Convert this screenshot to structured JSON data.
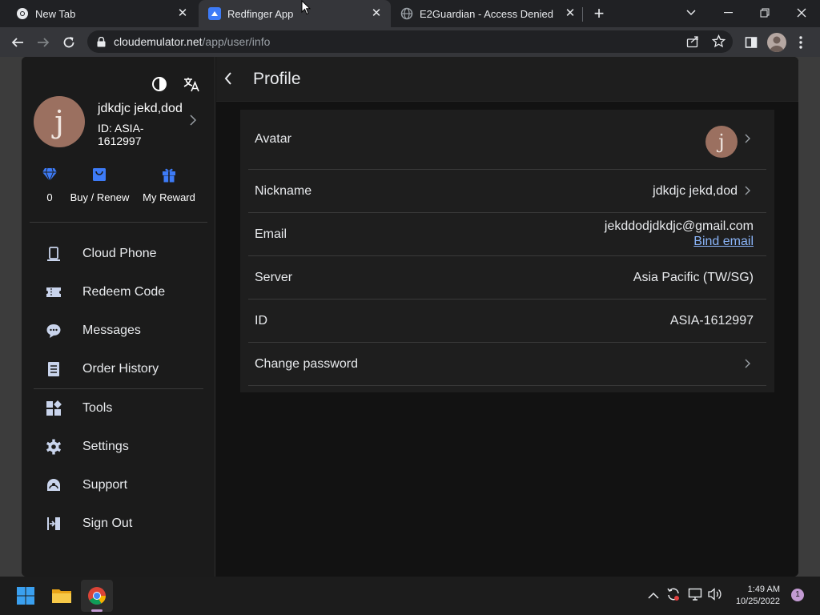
{
  "browser": {
    "tabs": [
      {
        "title": "New Tab",
        "active": false
      },
      {
        "title": "Redfinger App",
        "active": true
      },
      {
        "title": "E2Guardian - Access Denied",
        "active": false
      }
    ],
    "url_host": "cloudemulator.net",
    "url_path": "/app/user/info"
  },
  "sidebar": {
    "avatar_letter": "j",
    "username": "jdkdjc jekd,dod",
    "user_id_line1": "ID: ASIA-",
    "user_id_line2": "1612997",
    "quick": [
      {
        "label": "0",
        "icon": "diamond-icon"
      },
      {
        "label": "Buy / Renew",
        "icon": "shopping-bag-icon"
      },
      {
        "label": "My Reward",
        "icon": "gift-icon"
      }
    ],
    "menu": [
      {
        "label": "Cloud Phone",
        "icon": "cloud-phone-icon"
      },
      {
        "label": "Redeem Code",
        "icon": "ticket-icon"
      },
      {
        "label": "Messages",
        "icon": "message-icon"
      },
      {
        "label": "Order History",
        "icon": "order-list-icon"
      },
      {
        "label": "Tools",
        "icon": "tools-grid-icon"
      },
      {
        "label": "Settings",
        "icon": "gear-icon"
      },
      {
        "label": "Support",
        "icon": "support-icon"
      },
      {
        "label": "Sign Out",
        "icon": "sign-out-icon"
      }
    ]
  },
  "profile": {
    "title": "Profile",
    "rows": {
      "avatar_label": "Avatar",
      "avatar_letter": "j",
      "nickname_label": "Nickname",
      "nickname_value": "jdkdjc jekd,dod",
      "email_label": "Email",
      "email_value": "jekddodjdkdjc@gmail.com",
      "bind_email": "Bind email",
      "server_label": "Server",
      "server_value": "Asia Pacific (TW/SG)",
      "id_label": "ID",
      "id_value": "ASIA-1612997",
      "change_password_label": "Change password"
    }
  },
  "taskbar": {
    "time": "1:49 AM",
    "date": "10/25/2022",
    "notification_count": "1"
  },
  "colors": {
    "accent_blue": "#3d7bf7",
    "link_blue": "#8ab4f8",
    "avatar_brown": "#9b7060"
  }
}
